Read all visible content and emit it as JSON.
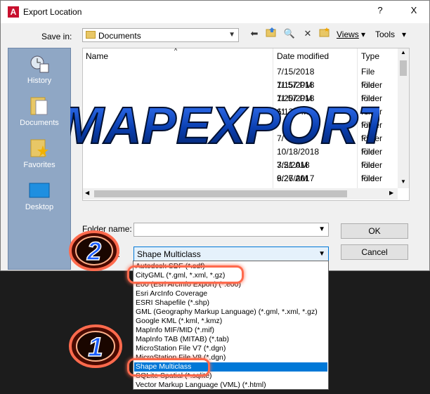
{
  "window": {
    "title": "Export Location",
    "help_label": "?",
    "close_label": "X"
  },
  "toolbar": {
    "save_in_label": "Save in:",
    "save_in_value": "Documents",
    "views_label": "Views",
    "tools_label": "Tools"
  },
  "places": [
    {
      "label": "History",
      "icon": "history-icon"
    },
    {
      "label": "Documents",
      "icon": "documents-icon"
    },
    {
      "label": "Favorites",
      "icon": "favorites-icon"
    },
    {
      "label": "Desktop",
      "icon": "desktop-icon"
    }
  ],
  "file_list": {
    "columns": [
      "Name",
      "Date modified",
      "Type"
    ],
    "rows": [
      {
        "date": "7/15/2018 11:57 PM",
        "type": "File folder"
      },
      {
        "date": "7/15/2018 11:57 PM",
        "type": "File folder"
      },
      {
        "date": "7/20/2018 6:13 PM",
        "type": "File folder"
      },
      {
        "date": "11",
        "type": "File folder"
      },
      {
        "date": "",
        "type": "File folder"
      },
      {
        "date": "7/",
        "type": "File folder"
      },
      {
        "date": "10/18/2018 3:21 AM",
        "type": "File folder"
      },
      {
        "date": "7/5/2018 6:27 AM",
        "type": "File folder"
      },
      {
        "date": "9/26/2017 9:06 PM",
        "type": "File folder"
      }
    ]
  },
  "form": {
    "folder_name_label": "Folder name:",
    "folder_name_value": "",
    "type_label": "e:",
    "type_value": "Shape Multiclass",
    "ok_label": "OK",
    "cancel_label": "Cancel"
  },
  "dropdown_options": [
    "Autodesk SDF (*.sdf)",
    "CityGML (*.gml, *.xml, *.gz)",
    "E00 (Esri ArcInfo Export) (*.e00)",
    "Esri ArcInfo Coverage",
    "ESRI Shapefile  (*.shp)",
    "GML (Geography Markup Language) (*.gml, *.xml, *.gz)",
    "Google KML (*.kml, *.kmz)",
    "MapInfo MIF/MID (*.mif)",
    "MapInfo TAB (MITAB) (*.tab)",
    "MicroStation File V7 (*.dgn)",
    "MicroStation File V8 (*.dgn)",
    "Shape Multiclass",
    "SQLite Spatial  (*.sqlite)",
    "Vector Markup Language (VML) (*.html)"
  ],
  "selected_option_index": 11,
  "overlay": {
    "banner": "MAPEXPORT",
    "step1": "1",
    "step2": "2"
  },
  "colors": {
    "accent": "#0078d7",
    "banner": "#0a3fb0",
    "ring": "#ff6a4d",
    "places": "#8fa7c5"
  }
}
